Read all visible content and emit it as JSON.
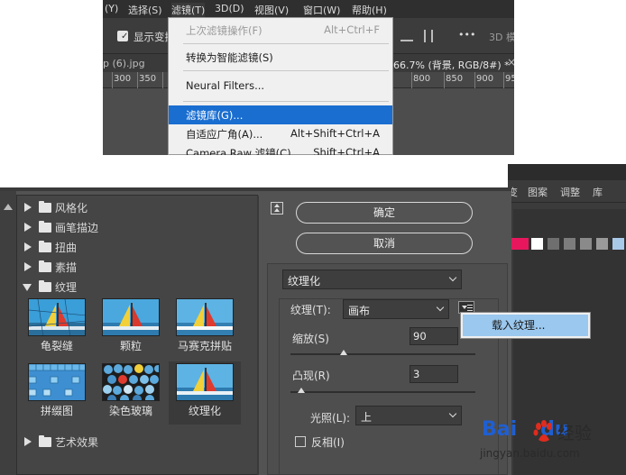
{
  "top_menu": {
    "items": [
      "(Y)",
      "选择(S)",
      "滤镜(T)",
      "3D(D)",
      "视图(V)",
      "窗口(W)",
      "帮助(H)"
    ]
  },
  "options_bar": {
    "show_transform": "显示变换",
    "more": "•••",
    "mode_3d": "3D 模"
  },
  "doc_tabs": {
    "left_tab": "p (6).jpg",
    "right_tab": "66.7% (背景, RGB/8#) *"
  },
  "ruler": {
    "labels": [
      "300",
      "350",
      "800",
      "850",
      "900",
      "95"
    ]
  },
  "filter_menu": {
    "items": [
      {
        "label": "上次滤镜操作(F)",
        "shortcut": "Alt+Ctrl+F",
        "disabled": true
      },
      {
        "label": "转换为智能滤镜(S)",
        "shortcut": ""
      },
      {
        "label": "Neural Filters...",
        "shortcut": ""
      },
      {
        "label": "滤镜库(G)...",
        "shortcut": "",
        "highlighted": true
      },
      {
        "label": "自适应广角(A)...",
        "shortcut": "Alt+Shift+Ctrl+A"
      },
      {
        "label": "Camera Raw 滤镜(C)...",
        "shortcut": "Shift+Ctrl+A"
      }
    ]
  },
  "filter_gallery": {
    "categories": [
      {
        "label": "风格化",
        "open": false
      },
      {
        "label": "画笔描边",
        "open": false
      },
      {
        "label": "扭曲",
        "open": false
      },
      {
        "label": "素描",
        "open": false
      },
      {
        "label": "纹理",
        "open": true
      },
      {
        "label": "艺术效果",
        "open": false
      }
    ],
    "thumbnails": [
      {
        "label": "龟裂缝",
        "selected": false
      },
      {
        "label": "颗粒",
        "selected": false
      },
      {
        "label": "马赛克拼贴",
        "selected": false
      },
      {
        "label": "拼缀图",
        "selected": false
      },
      {
        "label": "染色玻璃",
        "selected": false
      },
      {
        "label": "纹理化",
        "selected": true
      }
    ],
    "ok_button": "确定",
    "cancel_button": "取消",
    "effect_select": "纹理化",
    "texture_label": "纹理(T):",
    "texture_value": "画布",
    "scale_label": "缩放(S)",
    "scale_value": "90",
    "scale_fraction": 0.29,
    "relief_label": "凸现(R)",
    "relief_value": "3",
    "relief_fraction": 0.06,
    "light_label": "光照(L):",
    "light_value": "上",
    "invert_label": "反相(I)",
    "invert_checked": false,
    "load_texture": "载入纹理..."
  },
  "right_panel": {
    "tabs": [
      "变",
      "图案",
      "调整",
      "库"
    ],
    "swatches": [
      "#e8175d",
      "#e8175d",
      "#ffffff",
      "#6f6f6f",
      "#7c7c7c",
      "#8a8a8a",
      "#9a9a9a",
      "#a9c9e9"
    ]
  },
  "watermark": {
    "logo_bai": "Bai",
    "logo_du": "du",
    "jingyan": "经验",
    "url": "jingyan.baidu.com"
  }
}
